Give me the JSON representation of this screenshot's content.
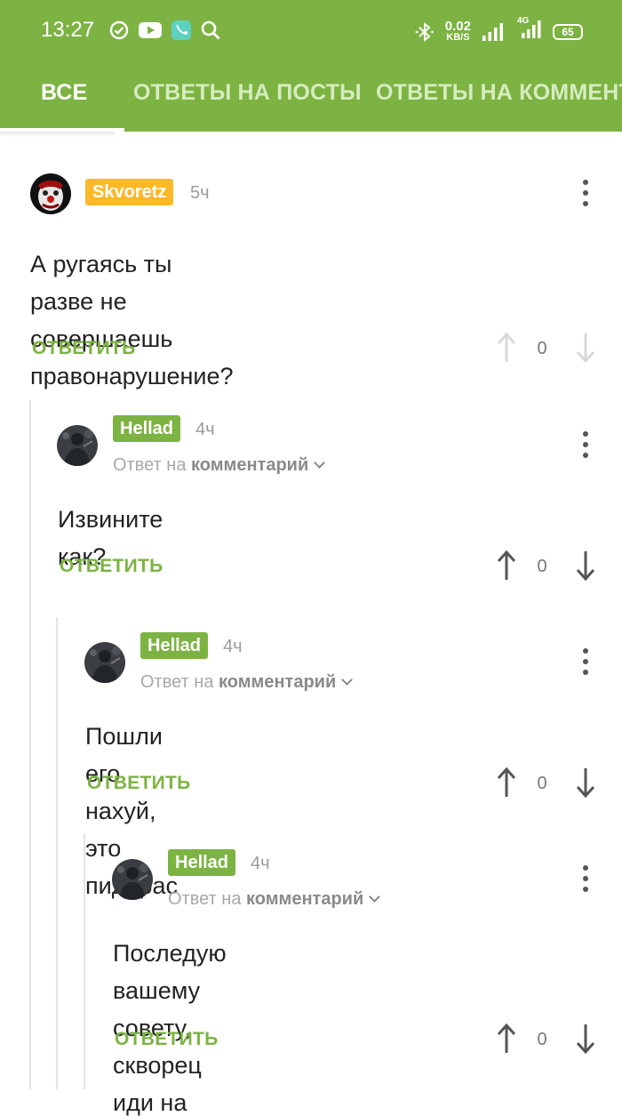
{
  "status": {
    "time": "13:27",
    "net_speed": "0.02",
    "net_unit": "KB/S",
    "network": "4G",
    "battery": "65"
  },
  "tabs": [
    {
      "label": "ВСЕ",
      "active": true
    },
    {
      "label": "ОТВЕТЫ НА ПОСТЫ",
      "active": false
    },
    {
      "label": "ОТВЕТЫ НА КОММЕНТАРИИ",
      "active": false
    }
  ],
  "comments": [
    {
      "author": "Skvoretz",
      "time": "5ч",
      "text_line1": "А ругаясь ты разве не совершаешь",
      "text_line2": "правонарушение?",
      "reply_label": "ОТВЕТИТЬ",
      "votes": "0"
    },
    {
      "author": "Hellad",
      "time": "4ч",
      "reply_to_prefix": "Ответ на",
      "reply_to_target": "комментарий",
      "text_line1": "Извините как?",
      "reply_label": "ОТВЕТИТЬ",
      "votes": "0"
    },
    {
      "author": "Hellad",
      "time": "4ч",
      "reply_to_prefix": "Ответ на",
      "reply_to_target": "комментарий",
      "text_line1": "Пошли его нахуй, это пидорас",
      "reply_label": "ОТВЕТИТЬ",
      "votes": "0"
    },
    {
      "author": "Hellad",
      "time": "4ч",
      "reply_to_prefix": "Ответ на",
      "reply_to_target": "комментарий",
      "text_line1": "Последую вашему совету, скворец",
      "text_line2": "иди на хуй",
      "reply_label": "ОТВЕТИТЬ",
      "votes": "0"
    }
  ],
  "colors": {
    "brand_green": "#7cb342",
    "author_gold": "#fbb829"
  },
  "icons": [
    "check-circle-icon",
    "youtube-icon",
    "phone-icon",
    "search-icon",
    "bluetooth-icon",
    "signal-icon",
    "battery-icon",
    "arrow-up-icon",
    "arrow-down-icon",
    "more-vert-icon",
    "chevron-down-icon"
  ]
}
